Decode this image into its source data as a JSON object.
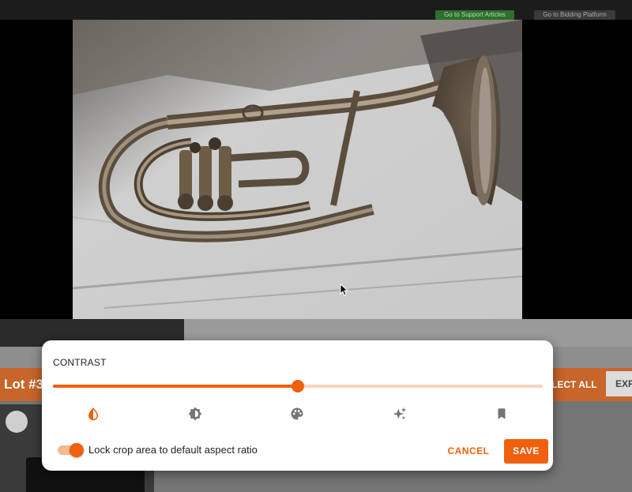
{
  "header": {
    "support_link": "Go to Support Articles",
    "bidding_link": "Go to Bidding Platform"
  },
  "editor": {
    "image_alt": "Brass euphonium/flugelhorn photo being edited"
  },
  "background": {
    "lot_label": "Lot #3",
    "select_all_label": "LECT ALL",
    "export_label": "EXP"
  },
  "panel": {
    "title": "CONTRAST",
    "slider_value_percent": 50,
    "tools": [
      {
        "name": "contrast-icon",
        "active": true
      },
      {
        "name": "brightness-icon",
        "active": false
      },
      {
        "name": "palette-icon",
        "active": false
      },
      {
        "name": "auto-enhance-icon",
        "active": false
      },
      {
        "name": "bookmark-icon",
        "active": false
      }
    ],
    "lock_label": "Lock crop area to default aspect ratio",
    "lock_enabled": true,
    "cancel_label": "CANCEL",
    "save_label": "SAVE"
  },
  "colors": {
    "accent": "#f0600d",
    "accent_light": "#f7d3be",
    "support_green": "#2f6e2c"
  }
}
